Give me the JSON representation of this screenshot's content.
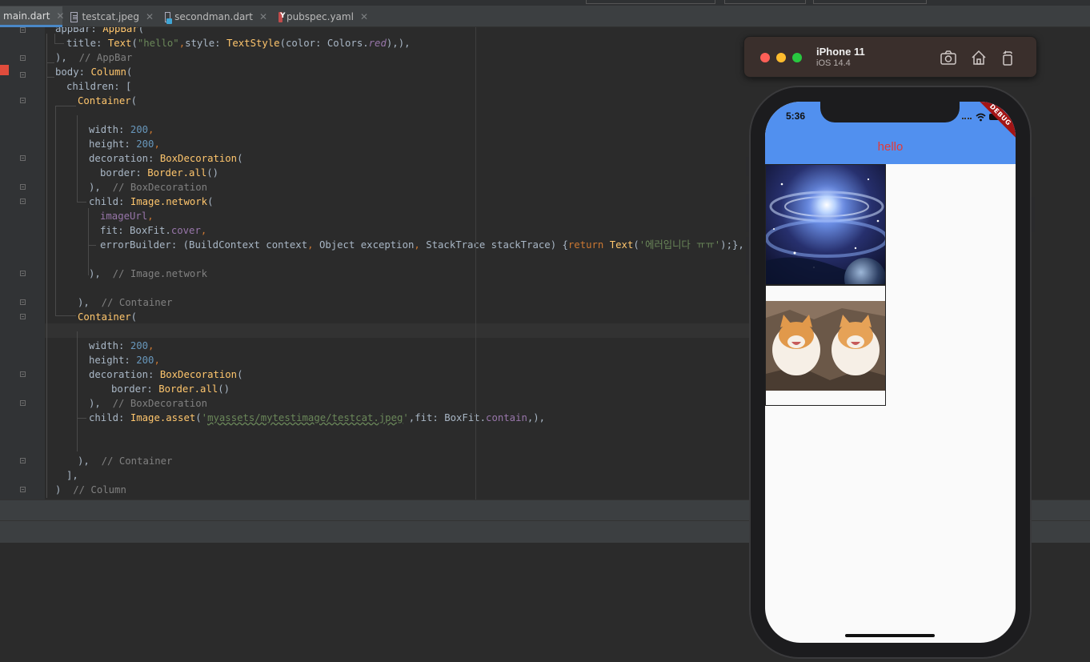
{
  "tabs": [
    {
      "label": "main.dart",
      "icon": "dart-file-icon",
      "active": true
    },
    {
      "label": "testcat.jpeg",
      "icon": "image-file-icon",
      "active": false
    },
    {
      "label": "secondman.dart",
      "icon": "dart-file-icon",
      "active": false
    },
    {
      "label": "pubspec.yaml",
      "icon": "yaml-file-icon",
      "active": false
    }
  ],
  "code": {
    "l0_a": "appBar",
    "l0_b": ": ",
    "l0_c": "AppBar",
    "l0_d": "(",
    "l1_a": "title",
    "l1_b": ": ",
    "l1_c": "Text",
    "l1_d": "(",
    "l1_e": "\"hello\"",
    "l1_f": ",",
    "l1_g": "style",
    "l1_h": ": ",
    "l1_i": "TextStyle",
    "l1_j": "(color: Colors.",
    "l1_k": "red",
    "l1_l": "),",
    "l1_m": "),",
    "l2_a": "), ",
    "l2_b": " // AppBar",
    "l3_a": "body",
    "l3_b": ": ",
    "l3_c": "Column",
    "l3_d": "(",
    "l4_a": "children: [",
    "l5_a": "Container",
    "l5_b": "(",
    "l7_a": "width: ",
    "l7_b": "200",
    "l7_c": ",",
    "l8_a": "height: ",
    "l8_b": "200",
    "l8_c": ",",
    "l9_a": "decoration: ",
    "l9_b": "BoxDecoration",
    "l9_c": "(",
    "l10_a": "border: ",
    "l10_b": "Border.all",
    "l10_c": "()",
    "l11_a": "), ",
    "l11_b": " // BoxDecoration",
    "l12_a": "child: ",
    "l12_b": "Image.network",
    "l12_c": "(",
    "l13_a": "imageUrl",
    "l13_b": ",",
    "l14_a": "fit: BoxFit.",
    "l14_b": "cover",
    "l14_c": ",",
    "l15_a": "errorBuilder: (BuildContext context",
    "l15_b": ", ",
    "l15_c": "Object exception",
    "l15_d": ", ",
    "l15_e": "StackTrace stackTrace) {",
    "l15_f": "return ",
    "l15_g": "Text",
    "l15_h": "(",
    "l15_i": "'에러입니다 ㅠㅠ'",
    "l15_j": ");},",
    "l17_a": "), ",
    "l17_b": " // Image.network",
    "l19_a": "), ",
    "l19_b": " // Container",
    "l20_a": "Container",
    "l20_b": "(",
    "l22_a": "width: ",
    "l22_b": "200",
    "l22_c": ",",
    "l23_a": "height: ",
    "l23_b": "200",
    "l23_c": ",",
    "l24_a": "decoration: ",
    "l24_b": "BoxDecoration",
    "l24_c": "(",
    "l25_a": "border: ",
    "l25_b": "Border.all",
    "l25_c": "()",
    "l26_a": "), ",
    "l26_b": " // BoxDecoration",
    "l27_a": "child: ",
    "l27_b": "Image.asset",
    "l27_c": "(",
    "l27_d": "'",
    "l27_e": "myassets/mytestimage/testcat.jpeg",
    "l27_f": "'",
    "l27_g": ",fit: BoxFit.",
    "l27_h": "contain",
    "l27_i": ",),",
    "l30_a": "), ",
    "l30_b": " // Container",
    "l31_a": "],",
    "l32_a": ")  ",
    "l32_b": "// Column"
  },
  "simulator": {
    "device_name": "iPhone 11",
    "os_version": "iOS 14.4",
    "toolbar_icons": [
      "screenshot-icon",
      "home-icon",
      "rotate-icon"
    ],
    "traffic_lights": {
      "close": "#ff5f57",
      "minimize": "#febc2e",
      "zoom": "#28c840"
    }
  },
  "app": {
    "status_time": "5:36",
    "title": "hello",
    "title_color": "#e53935",
    "appbar_color": "#5190ef",
    "debug_banner": "DEBUG",
    "images": [
      "galaxy-image",
      "cats-image"
    ]
  }
}
